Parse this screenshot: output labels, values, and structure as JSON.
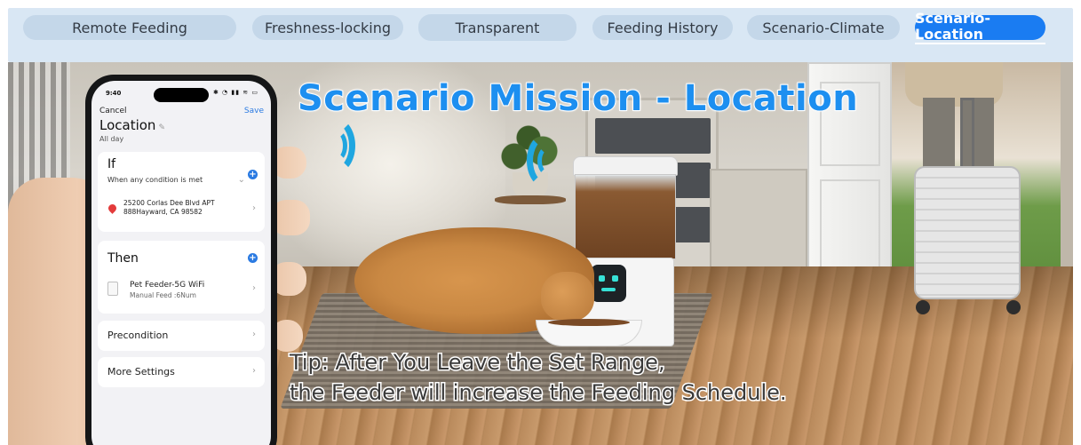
{
  "tabs": [
    {
      "label": "Remote Feeding",
      "active": false
    },
    {
      "label": "Freshness-locking",
      "active": false
    },
    {
      "label": "Transparent",
      "active": false
    },
    {
      "label": "Feeding History",
      "active": false
    },
    {
      "label": "Scenario-Climate",
      "active": false
    },
    {
      "label": "Scenario-Location",
      "active": true
    }
  ],
  "banner": {
    "headline": "Scenario Mission - Location",
    "tip_line1": "Tip: After You Leave the Set Range,",
    "tip_line2": "the Feeder will increase the Feeding Schedule."
  },
  "phone": {
    "status_time": "9:40",
    "cancel_label": "Cancel",
    "save_label": "Save",
    "title": "Location",
    "subtitle": "All day",
    "if_section": {
      "title": "If",
      "condition_mode": "When any condition is met",
      "address_line1": "25200 Corlas Dee Blvd APT",
      "address_line2": "888Hayward, CA 98582"
    },
    "then_section": {
      "title": "Then",
      "device_name": "Pet Feeder-5G WiFi",
      "device_action": "Manual Feed :6Num"
    },
    "precondition_label": "Precondition",
    "more_settings_label": "More Settings"
  },
  "colors": {
    "tab_active": "#1a7cf2",
    "tab_inactive": "#c4d7e9",
    "tabbar_bg": "#d9e7f4",
    "headline": "#1d8ff0",
    "link_blue": "#2a7ae2"
  }
}
